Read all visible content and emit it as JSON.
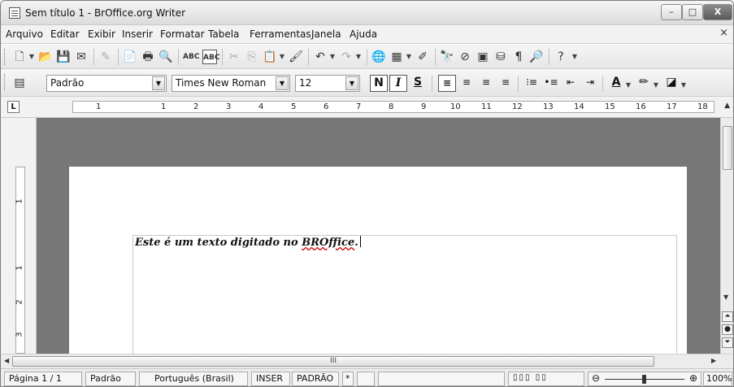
{
  "window": {
    "title": "Sem título 1 - BrOffice.org Writer",
    "minimize_label": "–",
    "maximize_label": "□",
    "close_label": "X"
  },
  "menu": {
    "items": [
      "Arquivo",
      "Editar",
      "Exibir",
      "Inserir",
      "Formatar",
      "Tabela",
      "Ferramentas",
      "Janela",
      "Ajuda"
    ],
    "close_doc": "×"
  },
  "format_toolbar": {
    "style": "Padrão",
    "font": "Times New Roman",
    "size": "12",
    "bold_label": "N",
    "italic_label": "I",
    "underline_label": "S"
  },
  "ruler": {
    "horizontal_numbers": [
      "1",
      "1",
      "2",
      "3",
      "4",
      "5",
      "6",
      "7",
      "8",
      "9",
      "10",
      "11",
      "12",
      "13",
      "14",
      "15",
      "16",
      "17",
      "18"
    ],
    "vertical_numbers": [
      "1",
      "1",
      "2",
      "3"
    ]
  },
  "document": {
    "text_before": "Este é um texto digitado no ",
    "text_misspelled": "BROffice",
    "text_after": "."
  },
  "scrollbar": {
    "h_thumb_label": "III"
  },
  "statusbar": {
    "page": "Página 1 / 1",
    "page_style": "Padrão",
    "language": "Português (Brasil)",
    "insert_mode": "INSER",
    "selection_mode": "PADRÃO",
    "modified": "*",
    "zoom": "100%"
  },
  "icons": [
    "new-icon",
    "open-icon",
    "save-icon",
    "email-icon",
    "edit-icon",
    "export-pdf-icon",
    "print-icon",
    "print-preview-icon",
    "spellcheck-icon",
    "autospell-icon",
    "cut-icon",
    "copy-icon",
    "paste-icon",
    "clone-format-icon",
    "undo-icon",
    "redo-icon",
    "hyperlink-icon",
    "table-icon",
    "draw-icon",
    "find-icon",
    "navigator-icon",
    "gallery-icon",
    "datasource-icon",
    "formatting-marks-icon",
    "zoom-icon",
    "help-icon"
  ]
}
